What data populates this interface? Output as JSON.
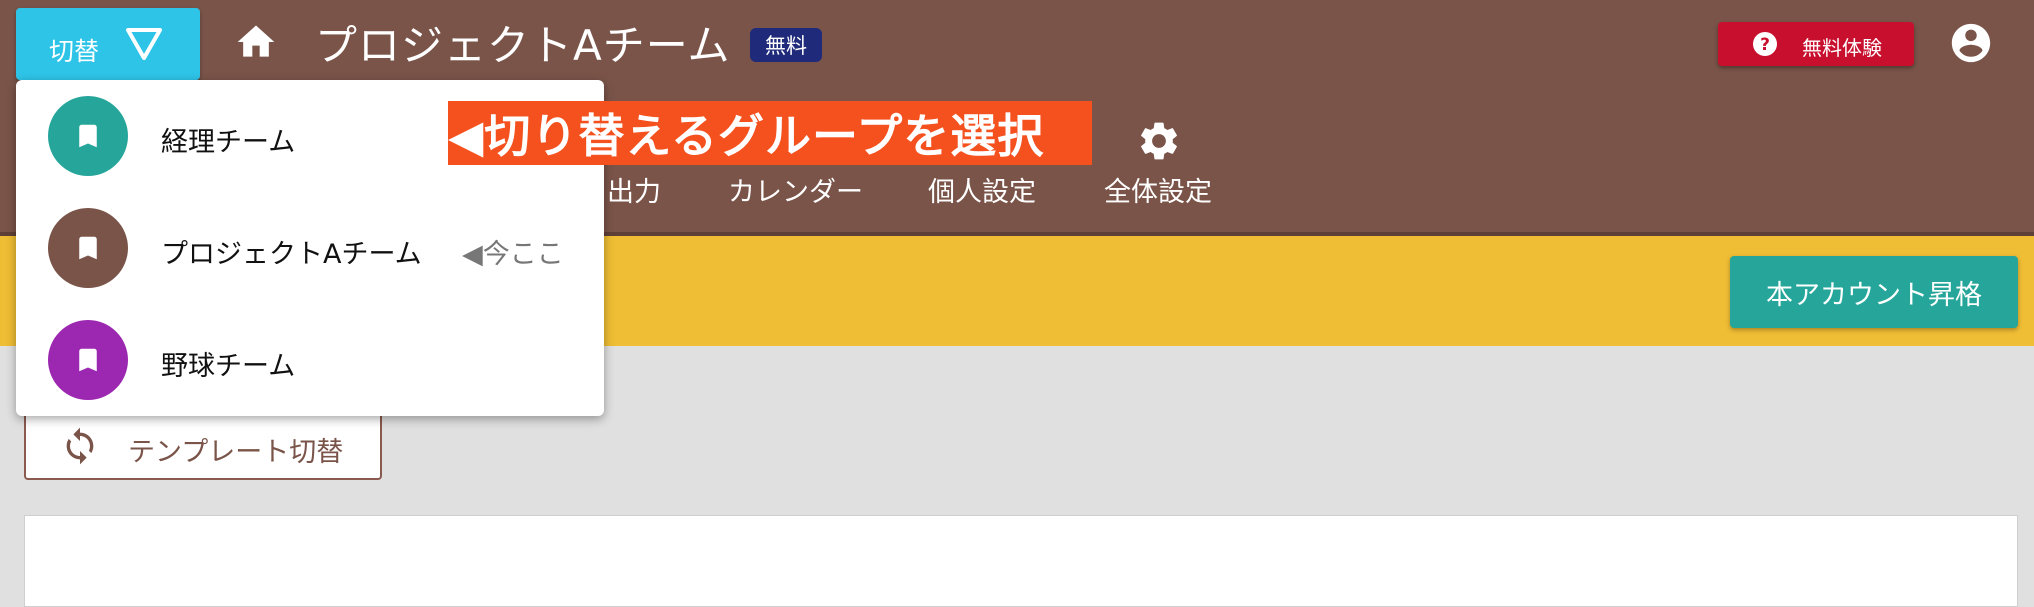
{
  "header": {
    "switch_label": "切替",
    "team_name": "プロジェクトAチーム",
    "plan_badge": "無料",
    "trial_label": "無料体験",
    "colors": {
      "header_bg": "#7a5449",
      "switch_bg": "#2ec4e8",
      "trial_bg": "#c8102e"
    }
  },
  "nav": {
    "items": [
      {
        "label": "出力"
      },
      {
        "label": "カレンダー"
      },
      {
        "label": "個人設定"
      },
      {
        "label": "全体設定"
      }
    ]
  },
  "banner": {
    "upgrade_label": "本アカウント昇格",
    "colors": {
      "banner_bg": "#f0be35",
      "upgrade_bg": "#26a69a"
    }
  },
  "main": {
    "template_switch_label": "テンプレート切替"
  },
  "dropdown": {
    "items": [
      {
        "label": "経理チーム",
        "color": "#26a69a",
        "icon": "bookmark-icon"
      },
      {
        "label": "プロジェクトAチーム",
        "color": "#7a5449",
        "icon": "bookmark-icon",
        "current_marker": "◀今ここ"
      },
      {
        "label": "野球チーム",
        "color": "#9c27b0",
        "icon": "bookmark-icon"
      }
    ]
  },
  "annotation": {
    "text": "◀切り替えるグループを選択",
    "color": "#f4511e"
  }
}
